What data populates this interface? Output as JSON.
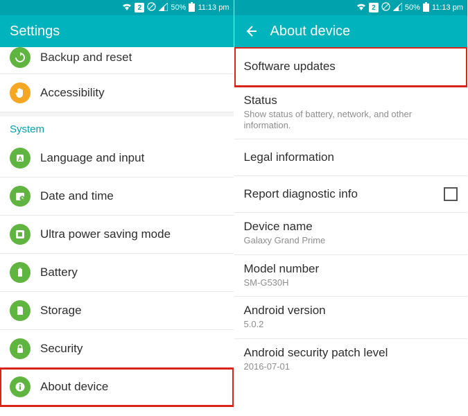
{
  "statusbar": {
    "sim": "2",
    "battery": "50%",
    "time": "11:13 pm"
  },
  "left": {
    "title": "Settings",
    "partial_row": "Backup and reset",
    "accessibility": "Accessibility",
    "system_header": "System",
    "items": [
      "Language and input",
      "Date and time",
      "Ultra power saving mode",
      "Battery",
      "Storage",
      "Security",
      "About device"
    ]
  },
  "right": {
    "title": "About device",
    "software_updates": "Software updates",
    "status": {
      "title": "Status",
      "sub": "Show status of battery, network, and other information."
    },
    "legal": "Legal information",
    "diag": "Report diagnostic info",
    "device_name": {
      "title": "Device name",
      "sub": "Galaxy Grand Prime"
    },
    "model": {
      "title": "Model number",
      "sub": "SM-G530H"
    },
    "android": {
      "title": "Android version",
      "sub": "5.0.2"
    },
    "patch": {
      "title": "Android security patch level",
      "sub": "2016-07-01"
    }
  }
}
